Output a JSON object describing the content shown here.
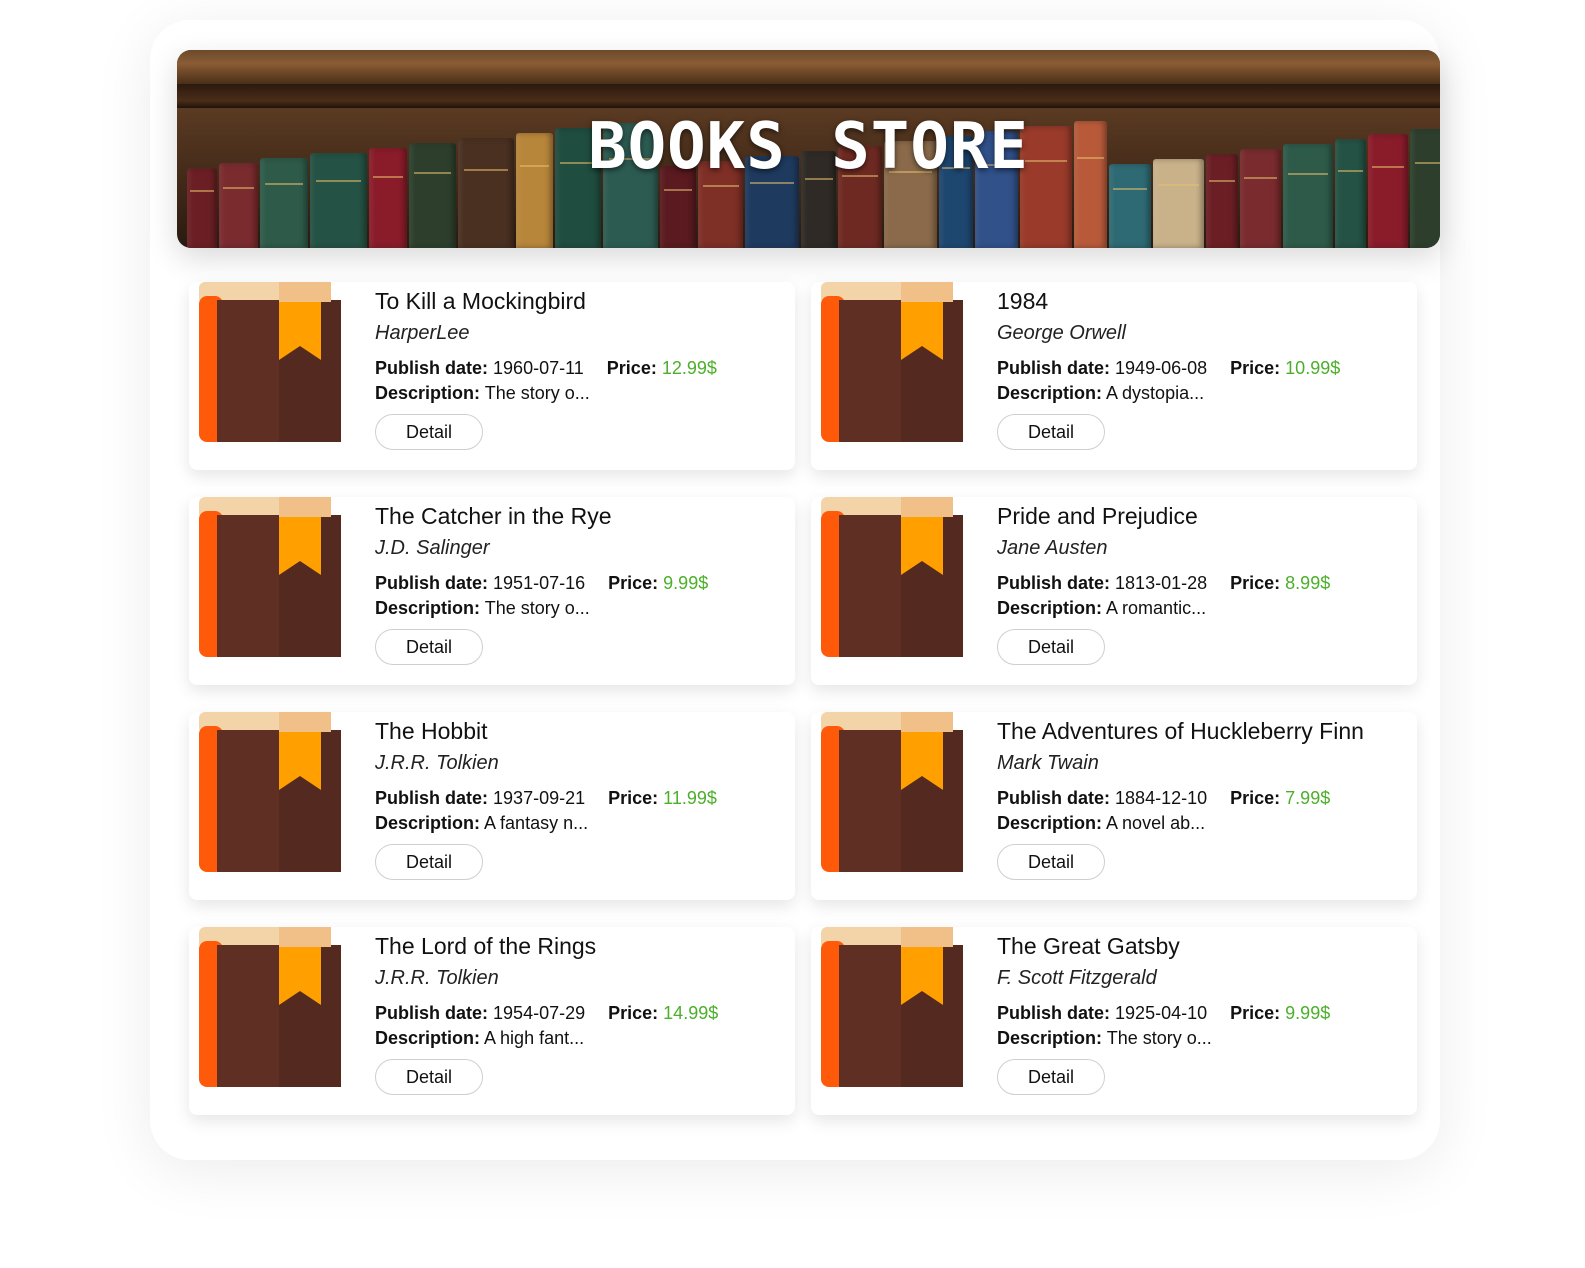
{
  "header": {
    "title": "BOOKS  STORE"
  },
  "colors": {
    "price": "#4caf2a",
    "cover_spine": "#ff5a0a",
    "cover_body": "#5e2f22",
    "cover_top": "#f3d4a8",
    "bookmark": "#ffa000"
  },
  "labels": {
    "publish_date": "Publish date:",
    "price": "Price:",
    "description": "Description:",
    "detail_button": "Detail",
    "currency_suffix": "$"
  },
  "books": [
    {
      "title": "To Kill a Mockingbird",
      "author": "HarperLee",
      "publish_date": "1960-07-11",
      "price": "12.99$",
      "description": "The story o..."
    },
    {
      "title": "1984",
      "author": "George Orwell",
      "publish_date": "1949-06-08",
      "price": "10.99$",
      "description": "A dystopia..."
    },
    {
      "title": "The Catcher in the Rye",
      "author": "J.D. Salinger",
      "publish_date": "1951-07-16",
      "price": "9.99$",
      "description": "The story o..."
    },
    {
      "title": "Pride and Prejudice",
      "author": "Jane Austen",
      "publish_date": "1813-01-28",
      "price": "8.99$",
      "description": "A romantic..."
    },
    {
      "title": "The Hobbit",
      "author": "J.R.R. Tolkien",
      "publish_date": "1937-09-21",
      "price": "11.99$",
      "description": "A fantasy n..."
    },
    {
      "title": "The Adventures of Huckleberry Finn",
      "author": "Mark Twain",
      "publish_date": "1884-12-10",
      "price": "7.99$",
      "description": "A novel ab..."
    },
    {
      "title": "The Lord of the Rings",
      "author": "J.R.R. Tolkien",
      "publish_date": "1954-07-29",
      "price": "14.99$",
      "description": "A high fant..."
    },
    {
      "title": "The Great Gatsby",
      "author": "F. Scott Fitzgerald",
      "publish_date": "1925-04-10",
      "price": "9.99$",
      "description": "The story o..."
    }
  ]
}
